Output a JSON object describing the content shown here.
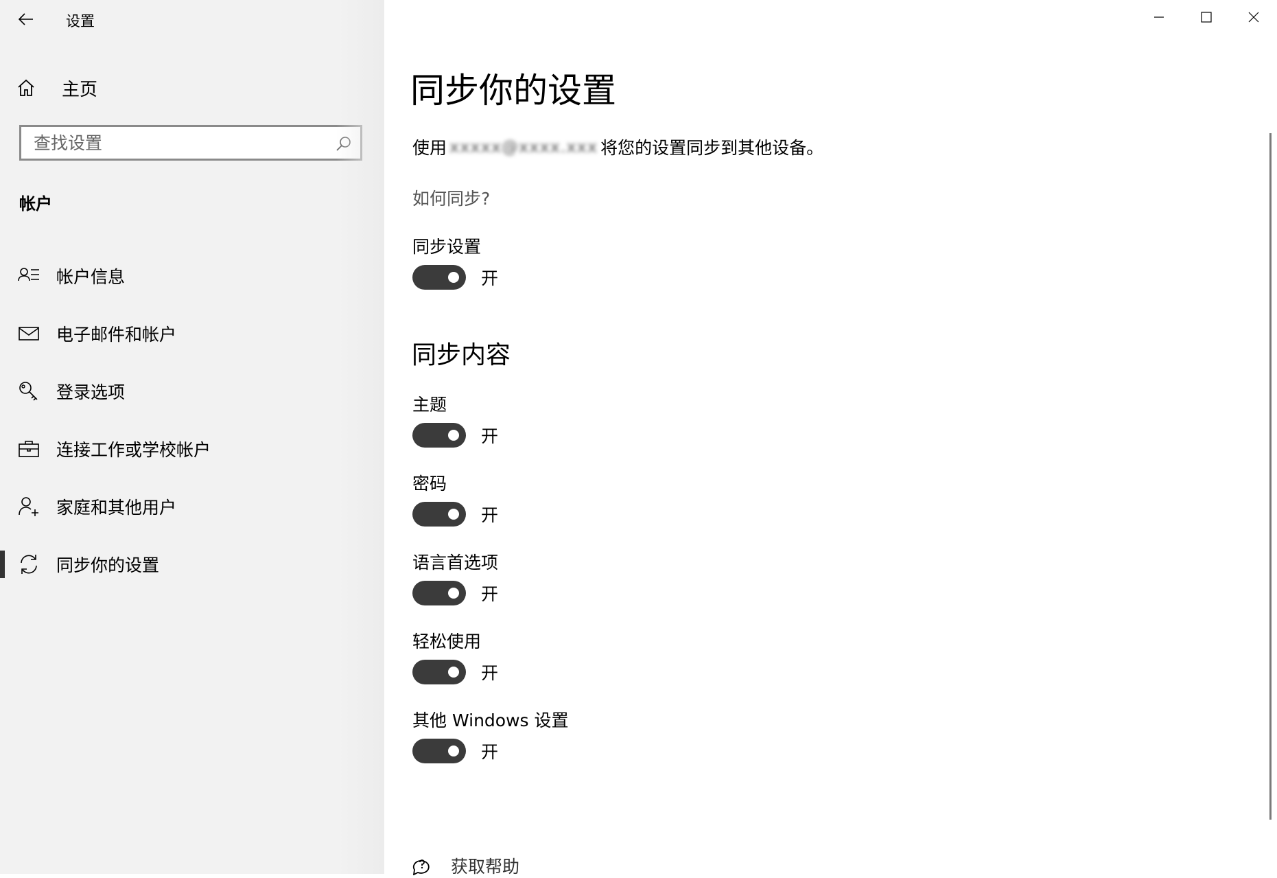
{
  "window": {
    "title": "设置",
    "controls": [
      "minimize-icon",
      "maximize-icon",
      "close-icon"
    ]
  },
  "sidebar": {
    "home_label": "主页",
    "search_placeholder": "查找设置",
    "section_title": "帐户",
    "items": [
      {
        "label": "帐户信息",
        "icon": "account-info-icon"
      },
      {
        "label": "电子邮件和帐户",
        "icon": "mail-icon"
      },
      {
        "label": "登录选项",
        "icon": "key-icon"
      },
      {
        "label": "连接工作或学校帐户",
        "icon": "briefcase-icon"
      },
      {
        "label": "家庭和其他用户",
        "icon": "add-person-icon"
      },
      {
        "label": "同步你的设置",
        "icon": "sync-icon",
        "active": true
      }
    ]
  },
  "main": {
    "title": "同步你的设置",
    "desc_prefix": "使用",
    "desc_email": "xxxxx@xxxx.xxx",
    "desc_suffix": "将您的设置同步到其他设备。",
    "how_link": "如何同步?",
    "sync_settings": {
      "label": "同步设置",
      "state": "开"
    },
    "content_title": "同步内容",
    "content_items": [
      {
        "label": "主题",
        "state": "开"
      },
      {
        "label": "密码",
        "state": "开"
      },
      {
        "label": "语言首选项",
        "state": "开"
      },
      {
        "label": "轻松使用",
        "state": "开"
      },
      {
        "label": "其他 Windows 设置",
        "state": "开"
      }
    ],
    "help_label": "获取帮助"
  },
  "colors": {
    "sidebar_bg": "#f2f2f2",
    "toggle_on": "#3b3b3b",
    "active_indicator": "#333333"
  }
}
